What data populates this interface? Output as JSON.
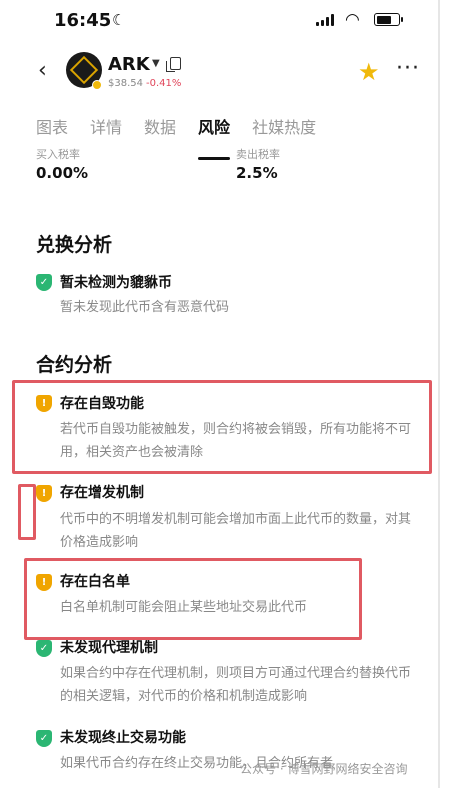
{
  "status_bar": {
    "time": "16:45"
  },
  "header": {
    "coin": "ARK",
    "price": "$38.54",
    "change": "-0.41%",
    "accent": "#f0b90b"
  },
  "tabs": [
    {
      "label": "图表"
    },
    {
      "label": "详情"
    },
    {
      "label": "数据"
    },
    {
      "label": "风险",
      "active": true
    },
    {
      "label": "社媒热度"
    }
  ],
  "tax": {
    "buy_label": "买入税率",
    "buy_value": "0.00%",
    "sell_label": "卖出税率",
    "sell_value": "2.5%"
  },
  "exchange_analysis": {
    "title": "兑换分析",
    "items": [
      {
        "status": "ok",
        "title": "暂未检测为貔貅币",
        "desc": "暂未发现此代币含有恶意代码"
      }
    ]
  },
  "contract_analysis": {
    "title": "合约分析",
    "items": [
      {
        "status": "warn",
        "title": "存在自毁功能",
        "desc": "若代币自毁功能被触发，则合约将被会销毁，所有功能将不可用，相关资产也会被清除"
      },
      {
        "status": "warn",
        "title": "存在增发机制",
        "desc": "代币中的不明增发机制可能会增加市面上此代币的数量，对其价格造成影响"
      },
      {
        "status": "warn",
        "title": "存在白名单",
        "desc": "白名单机制可能会阻止某些地址交易此代币"
      },
      {
        "status": "ok",
        "title": "未发现代理机制",
        "desc": "如果合约中存在代理机制，则项目方可通过代理合约替换代币的相关逻辑，对代币的价格和机制造成影响"
      },
      {
        "status": "ok",
        "title": "未发现终止交易功能",
        "desc": "如果代币合约存在终止交易功能，且合约所有者"
      }
    ]
  },
  "watermark": "公众号 · 博雪网野网络安全咨询",
  "colors": {
    "ok": "#2bb673",
    "warn": "#f0a500",
    "highlight": "#e05a62",
    "negative": "#e0455a"
  }
}
